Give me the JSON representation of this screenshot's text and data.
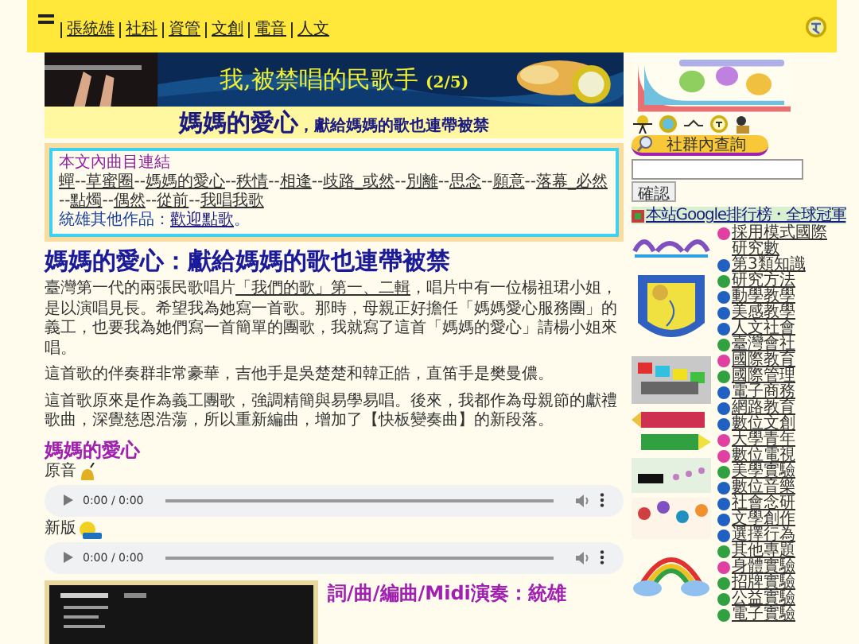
{
  "top_nav": {
    "items": [
      "張統雄",
      "社科",
      "資管",
      "文創",
      "電音",
      "人文"
    ]
  },
  "banner": {
    "title": "我,被禁唱的民歌手",
    "part": "(2/5)"
  },
  "subtitle": {
    "main": "媽媽的愛心",
    "rest": "，獻給媽媽的歌也連帶被禁"
  },
  "track_links": {
    "title": "本文內曲目連結",
    "separator": "--",
    "links": [
      "蟬",
      "草蜜圈",
      "媽媽的愛心",
      "秩情",
      "相逢",
      "歧路_或然",
      "別離",
      "思念",
      "願意",
      "落幕_必然",
      "點燭",
      "偶然",
      "從前",
      "我唱我歌"
    ],
    "other_label": "統雄其他作品：",
    "other_link": "歡迎點歌",
    "other_end": "。"
  },
  "article": {
    "heading": "媽媽的愛心：獻給媽媽的歌也連帶被禁",
    "p1": {
      "before": "臺灣第一代的兩張民歌唱片",
      "link": "「我們的歌」第一、二輯",
      "after": "，唱片中有一位楊祖珺小姐，是以演唱見長。希望我為她寫一首歌。那時，母親正好擔任「媽媽愛心服務團」的義工，也要我為她們寫一首簡單的團歌，我就寫了這首「媽媽的愛心」請楊小姐來唱。"
    },
    "p2": "這首歌的伴奏群非常豪華，吉他手是吳楚楚和韓正皓，直笛手是樊曼儂。",
    "p3": "這首歌原來是作為義工團歌，強調精簡與易學易唱。後來，我都作為母親節的獻禮歌曲，深覺慈恩浩蕩，所以重新編曲，增加了【快板變奏曲】的新段落。"
  },
  "song": {
    "title": "媽媽的愛心",
    "versions": [
      {
        "label": "原音",
        "time": "0:00 / 0:00"
      },
      {
        "label": "新版",
        "time": "0:00 / 0:00"
      }
    ],
    "credits": "詞/曲/編曲/Midi演奏：統雄"
  },
  "sidebar": {
    "search_button": "社群內查詢",
    "confirm_button": "確認",
    "ranking_link": "本站Google排行榜・全球冠軍",
    "topics": [
      {
        "label": "採用模式國際研究數",
        "color": "#e040a0"
      },
      {
        "label": "第3類知識",
        "color": "#2060c0"
      },
      {
        "label": "研究方法",
        "color": "#30a040"
      },
      {
        "label": "動學教學",
        "color": "#2060c0"
      },
      {
        "label": "美感教學",
        "color": "#2060c0"
      },
      {
        "label": "人文社會",
        "color": "#2060c0"
      },
      {
        "label": "臺灣會社",
        "color": "#30a040"
      },
      {
        "label": "國際教育",
        "color": "#e040a0"
      },
      {
        "label": "國際管理",
        "color": "#30a040"
      },
      {
        "label": "電子商務",
        "color": "#2060c0"
      },
      {
        "label": "網路教育",
        "color": "#2060c0"
      },
      {
        "label": "數位文創",
        "color": "#2060c0"
      },
      {
        "label": "大學青年",
        "color": "#e040a0"
      },
      {
        "label": "數位電視",
        "color": "#e040a0"
      },
      {
        "label": "美學實驗",
        "color": "#30a040"
      },
      {
        "label": "數位音樂",
        "color": "#2060c0"
      },
      {
        "label": "社會念研",
        "color": "#2060c0"
      },
      {
        "label": "文學創作",
        "color": "#2060c0"
      },
      {
        "label": "選擇行為",
        "color": "#2060c0"
      },
      {
        "label": "其他專題",
        "color": "#30a040"
      },
      {
        "label": "身體實驗",
        "color": "#e040a0"
      },
      {
        "label": "招牌實驗",
        "color": "#30a040"
      },
      {
        "label": "公益實驗",
        "color": "#30a040"
      },
      {
        "label": "電子實驗",
        "color": "#30a040"
      }
    ]
  }
}
